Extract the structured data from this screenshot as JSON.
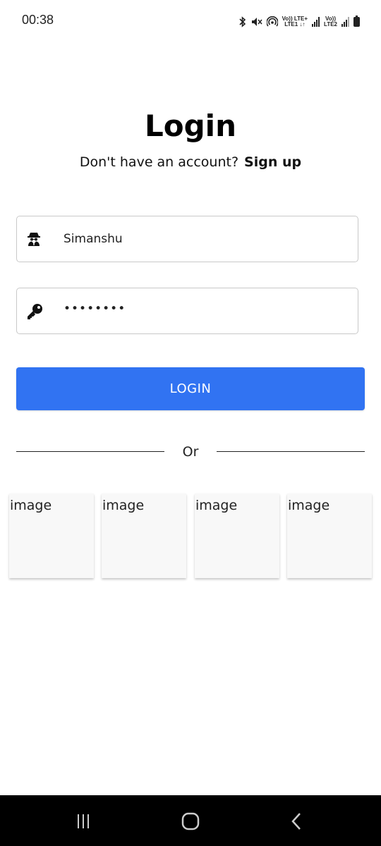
{
  "status_bar": {
    "time": "00:38",
    "sim1_top": "Vo)) LTE+",
    "sim1_bottom": "LTE1 ↓↑",
    "sim2_top": "Vo))",
    "sim2_bottom": "LTE2"
  },
  "login": {
    "title": "Login",
    "subtitle": "Don't have an account?",
    "signup_link": "Sign up",
    "username_value": "Simanshu",
    "password_value": "••••••••",
    "button_label": "LOGIN",
    "divider_text": "Or"
  },
  "social": {
    "tiles": [
      {
        "label": "image"
      },
      {
        "label": "image"
      },
      {
        "label": "image"
      },
      {
        "label": "image"
      }
    ]
  },
  "colors": {
    "accent": "#3173f2",
    "navbar": "#000000"
  },
  "icons": {
    "username": "incognito-user-icon",
    "password": "key-icon"
  }
}
